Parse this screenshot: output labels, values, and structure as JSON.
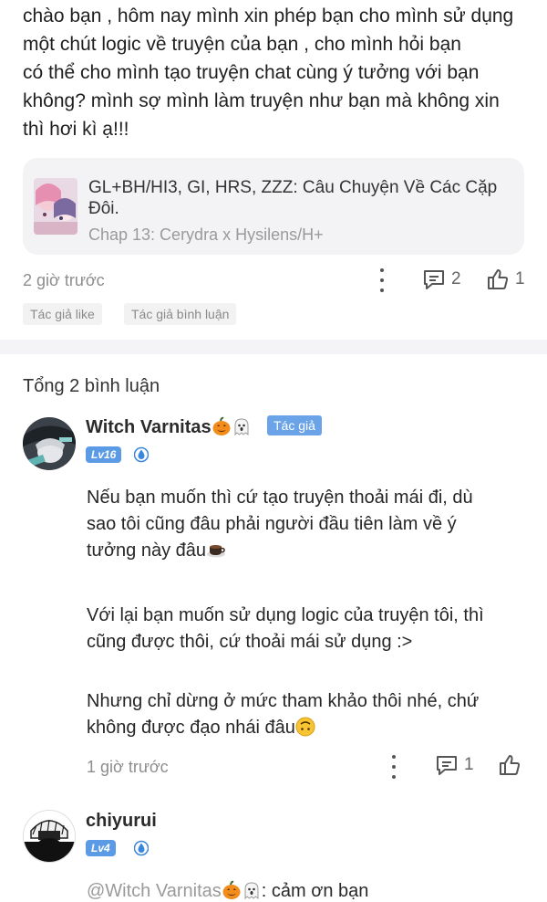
{
  "post": {
    "lines": [
      "chào bạn , hôm nay mình xin phép bạn cho mình sử dụng",
      "một chút logic về truyện của bạn , cho mình hỏi bạn",
      "có thể cho mình tạo truyện chat cùng ý tưởng với bạn",
      "không? mình sợ mình làm truyện như bạn mà không xin",
      "thì hơi kì ạ!!!"
    ],
    "story": {
      "title": "GL+BH/HI3, GI, HRS, ZZZ: Câu Chuyện Về Các Cặp Đôi.",
      "chapter": "Chap 13: Cerydra x Hysilens/H+"
    },
    "time": "2 giờ trước",
    "comment_count": "2",
    "like_count": "1",
    "tags": [
      "Tác giả like",
      "Tác giả bình luận"
    ]
  },
  "comments_section": {
    "total_label": "Tổng 2 bình luận"
  },
  "comments": [
    {
      "username": "Witch Varnitas",
      "author_badge": "Tác giả",
      "level": "Lv16",
      "paragraphs": [
        [
          "Nếu bạn muốn thì cứ tạo truyện thoải mái đi, dù",
          "sao tôi cũng đâu phải người đầu tiên làm về ý",
          "tưởng này đâu"
        ],
        [
          "Với lại bạn muốn sử dụng logic của truyện tôi, thì",
          "cũng được thôi, cứ thoải mái sử dụng :>"
        ],
        [
          "Nhưng chỉ dừng ở mức tham khảo thôi nhé, chứ",
          "không được đạo nhái đâu"
        ]
      ],
      "time": "1 giờ trước",
      "reply_count": "1"
    },
    {
      "username": "chiyurui",
      "level": "Lv4",
      "reply_mention": "@Witch Varnitas",
      "reply_text": ": cảm ơn bạn"
    }
  ],
  "icons": {
    "kebab": "more-options-icon",
    "comment": "comment-icon",
    "like": "thumbs-up-icon",
    "vip": "vip-droplet-icon",
    "emoji_pumpkin": "jack-o-lantern-icon",
    "emoji_ghost": "ghost-icon",
    "emoji_coffee": "coffee-icon",
    "emoji_upside": "upside-down-face-icon"
  },
  "colors": {
    "accent": "#5b9be6",
    "muted": "#8d8d8d",
    "card_bg": "#f3f3f5"
  }
}
